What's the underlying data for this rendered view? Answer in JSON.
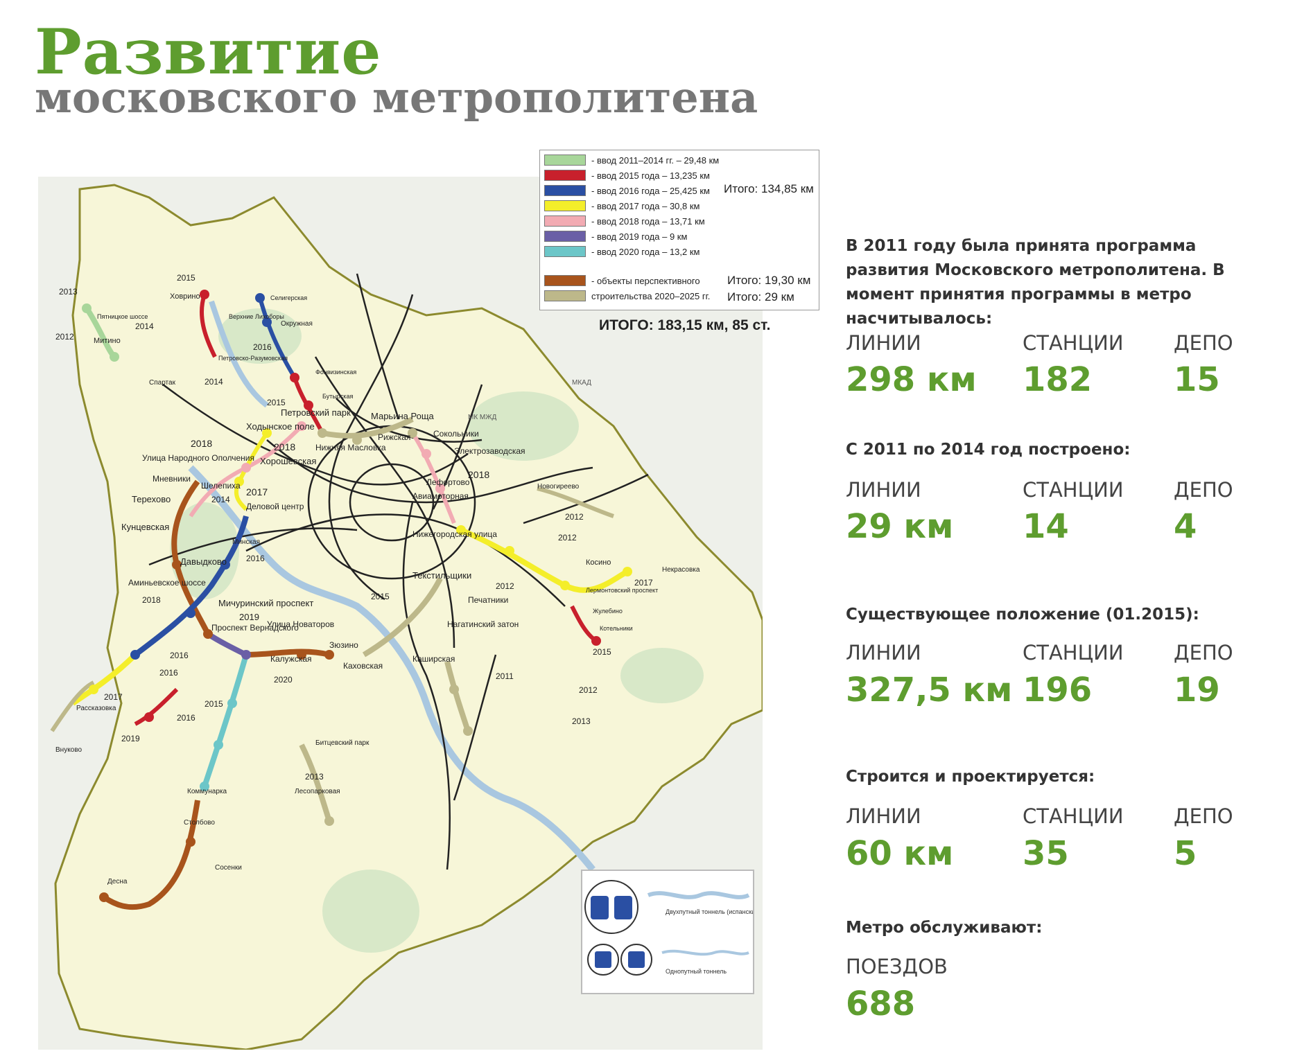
{
  "title": {
    "line1": "Развитие",
    "line2": "московского метрополитена"
  },
  "legend": {
    "items": [
      {
        "color": "#a8d69a",
        "text": "- ввод 2011–2014 гг. – 29,48 км"
      },
      {
        "color": "#c8202c",
        "text": "- ввод 2015 года – 13,235 км"
      },
      {
        "color": "#2a4fa3",
        "text": "- ввод 2016 года – 25,425 км"
      },
      {
        "color": "#f4ee2a",
        "text": "- ввод 2017 года – 30,8 км"
      },
      {
        "color": "#f2abb3",
        "text": "- ввод 2018 года – 13,71 км"
      },
      {
        "color": "#6a5fa6",
        "text": "- ввод 2019 года – 9 км"
      },
      {
        "color": "#6cc6c8",
        "text": "- ввод 2020 года – 13,2 км"
      }
    ],
    "total1": "Итого: 134,85 км",
    "perspective": [
      {
        "color": "#a8541c",
        "text": "- объекты перспективного"
      },
      {
        "color": "#bdb88a",
        "text": "строительства 2020–2025 гг."
      }
    ],
    "total2": "Итого: 19,30 км",
    "total3": "Итого: 29 км",
    "grand_total": "ИТОГО: 183,15 км, 85 ст."
  },
  "map": {
    "labels": {
      "l2015_a": "2015",
      "khovrino": "Ховрино",
      "l2013": "2013",
      "l2014_a": "2014",
      "l2012_a": "2012",
      "mitino": "Митино",
      "pyatnitskoe": "Пятницкое шоссе",
      "seligerskaya": "Селигерская",
      "verkhnie": "Верхние Лихоборы",
      "okruzhnaya": "Окружная",
      "l2016_a": "2016",
      "petrovsko": "Петровско-Разумовская",
      "fonvizinskaya": "Фонвизинская",
      "butyrskaya": "Бутырская",
      "l2015_b": "2015",
      "spartak": "Спартак",
      "l2014_b": "2014",
      "maryina": "Марьина Роща",
      "petrovsky": "Петровский парк",
      "khodynskoe": "Ходынское поле",
      "l2018_a": "2018",
      "nizhnyaya": "Нижняя Масловка",
      "rizhskaya": "Рижская",
      "sokolniki": "Сокольники",
      "electrozavod": "Электрозаводская",
      "l2018_b": "2018",
      "ulitsa_no": "Улица Народного Ополчения",
      "khoroshevskaya": "Хорошевская",
      "mnevniki": "Мневники",
      "shelepikha": "Шелепиха",
      "l2017_a": "2017",
      "delovoy": "Деловой центр",
      "lefortovo": "Лефортово",
      "l2018_c": "2018",
      "aviamotornaya": "Авиамоторная",
      "novogireevo": "Новогиреево",
      "terekhovo": "Терехово",
      "kuntsevskaya": "Кунцевская",
      "l2014_c": "2014",
      "l2012_b": "2012",
      "nizhegorodskaya": "Нижегородская улица",
      "l2012_c": "2012",
      "l2017_b": "2017",
      "davydkovo": "Давыдково",
      "minskaya": "Минская",
      "l2016_b": "2016",
      "tekstilshchiki": "Текстильщики",
      "kosino": "Косино",
      "nekrasovka": "Некрасовка",
      "aminevskoe": "Аминьевское шоссе",
      "l2018_d": "2018",
      "michurinsky": "Мичуринский проспект",
      "l2019_a": "2019",
      "l2015_c": "2015",
      "pechatniki": "Печатники",
      "l2012_d": "2012",
      "lermontovsky": "Лермонтовский проспект",
      "zhulebino": "Жулебино",
      "kotelniki": "Котельники",
      "l2015_d": "2015",
      "prospekt_vern": "Проспект Вернадского",
      "ulitsa_novatorov": "Улица Новаторов",
      "nagatinsky": "Нагатинский затон",
      "zyuzino": "Зюзино",
      "l2016_c": "2016",
      "kaluzhskaya": "Калужская",
      "kakhovskaya": "Каховская",
      "kashirskaya": "Каширская",
      "l2016_d": "2016",
      "l2020": "2020",
      "l2011": "2011",
      "l2012_e": "2012",
      "l2017_c": "2017",
      "l2015_e": "2015",
      "l2016_e": "2016",
      "rasskazovka": "Рассказовка",
      "l2013_b": "2013",
      "l2019_b": "2019",
      "vnukovo": "Внуково",
      "bitsevsky": "Битцевский парк",
      "l2013_c": "2013",
      "lesoparkovaya": "Лесопарковая",
      "kommunarka": "Коммунарка",
      "stolbovo": "Столбово",
      "desna": "Десна",
      "sosenki": "Сосенки",
      "mkad": "МКАД",
      "mkzhd": "МК МЖД"
    },
    "tunnel_legend": {
      "double": "Двухпутный тоннель (испанский метод)",
      "single": "Однопутный тоннель"
    }
  },
  "stats": {
    "intro": "В 2011 году была принята программа развития Московского метрополитена. В момент принятия программы в метро насчитывалось:",
    "labels": {
      "lines": "ЛИНИИ",
      "stations": "СТАНЦИИ",
      "depots": "ДЕПО",
      "trains": "ПОЕЗДОВ"
    },
    "initial": {
      "lines": "298 км",
      "stations": "182",
      "depots": "15"
    },
    "built_title": "С 2011 по 2014 год построено:",
    "built": {
      "lines": "29 км",
      "stations": "14",
      "depots": "4"
    },
    "current_title": "Существующее положение (01.2015):",
    "current": {
      "lines": "327,5 км",
      "stations": "196",
      "depots": "19"
    },
    "construction_title": "Строится и проектируется:",
    "construction": {
      "lines": "60 км",
      "stations": "35",
      "depots": "5"
    },
    "service_title": "Метро обслуживают:",
    "trains": "688"
  }
}
